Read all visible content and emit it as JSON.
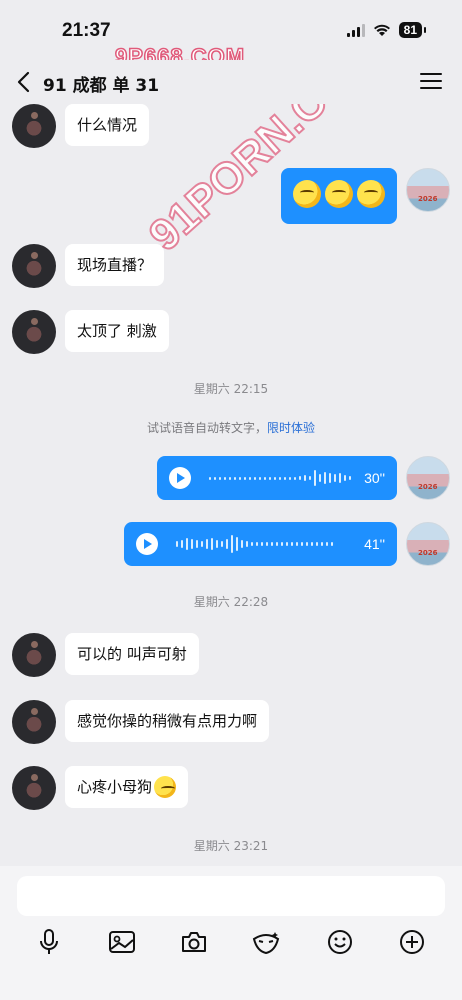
{
  "status_bar": {
    "time": "21:37",
    "battery": "81"
  },
  "watermarks": {
    "top": "9P668.COM",
    "middle": "91PORN.COM"
  },
  "header": {
    "title": "91 成都 单 31"
  },
  "messages": [
    {
      "side": "left",
      "text": "什么情况"
    },
    {
      "side": "right",
      "emoji_count": 3
    },
    {
      "side": "left",
      "text": "现场直播？"
    },
    {
      "side": "left",
      "text": "太顶了  刺激"
    },
    {
      "timestamp": "星期六 22:15"
    },
    {
      "hint": "试试语音自动转文字，",
      "hint_link": "限时体验"
    },
    {
      "side": "right",
      "voice_duration": "30''"
    },
    {
      "side": "right",
      "voice_duration": "41''"
    },
    {
      "timestamp": "星期六 22:28"
    },
    {
      "side": "left",
      "text": "可以的  叫声可射"
    },
    {
      "side": "left",
      "text": "感觉你操的稍微有点用力啊"
    },
    {
      "side": "left",
      "text": "心疼小母狗"
    },
    {
      "timestamp": "星期六 23:21"
    }
  ],
  "input": {
    "placeholder": ""
  },
  "toolbar": {
    "icons": [
      "mic-icon",
      "image-icon",
      "camera-icon",
      "sticker-icon",
      "emoji-icon",
      "plus-icon"
    ]
  }
}
